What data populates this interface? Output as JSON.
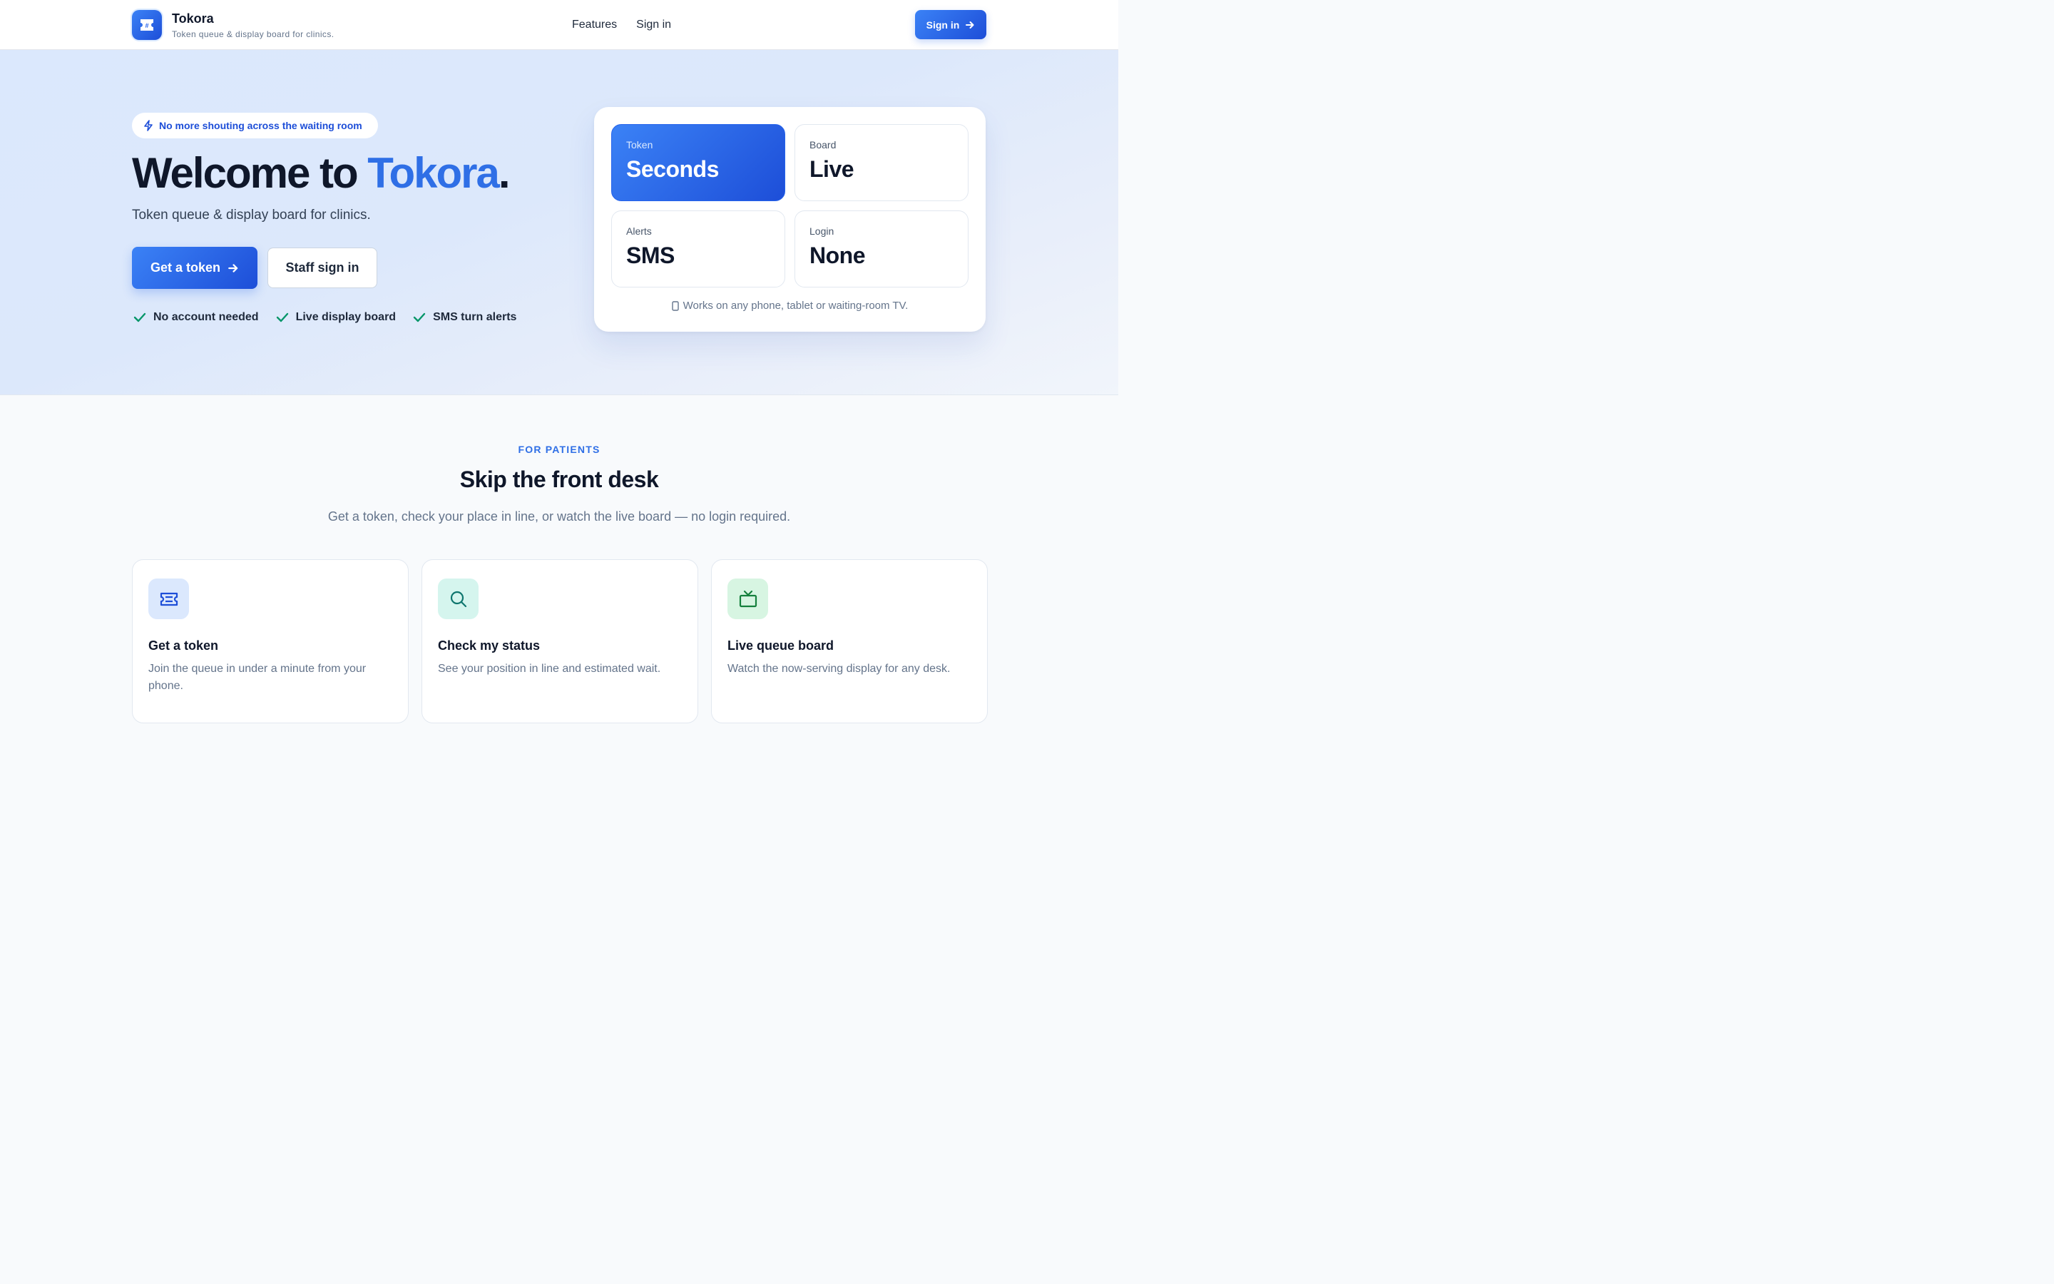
{
  "header": {
    "brand_name": "Tokora",
    "brand_tagline": "Token queue & display board for clinics.",
    "nav": [
      {
        "label": "Features"
      },
      {
        "label": "Sign in"
      }
    ],
    "cta_label": "Sign in"
  },
  "hero": {
    "pill_text": "No more shouting across the waiting room",
    "title_prefix": "Welcome to ",
    "title_accent": "Tokora",
    "title_suffix": ".",
    "subtitle": "Token queue & display board for clinics.",
    "primary_button": "Get a token",
    "secondary_button": "Staff sign in",
    "checks": [
      "No account needed",
      "Live display board",
      "SMS turn alerts"
    ]
  },
  "stats": {
    "items": [
      {
        "key": "Token",
        "value": "Seconds"
      },
      {
        "key": "Board",
        "value": "Live"
      },
      {
        "key": "Alerts",
        "value": "SMS"
      },
      {
        "key": "Login",
        "value": "None"
      }
    ],
    "footer": "Works on any phone, tablet or waiting-room TV."
  },
  "patients": {
    "eyebrow": "FOR PATIENTS",
    "title": "Skip the front desk",
    "subtitle": "Get a token, check your place in line, or watch the live board — no login required.",
    "cards": [
      {
        "title": "Get a token",
        "desc": "Join the queue in under a minute from your phone.",
        "icon": "ticket-icon"
      },
      {
        "title": "Check my status",
        "desc": "See your position in line and estimated wait.",
        "icon": "search-icon"
      },
      {
        "title": "Live queue board",
        "desc": "Watch the now-serving display for any desk.",
        "icon": "tv-icon"
      }
    ]
  },
  "colors": {
    "accent": "#2f6fe6",
    "brand_blue": "#1d4ed8",
    "check_green": "#059669"
  }
}
